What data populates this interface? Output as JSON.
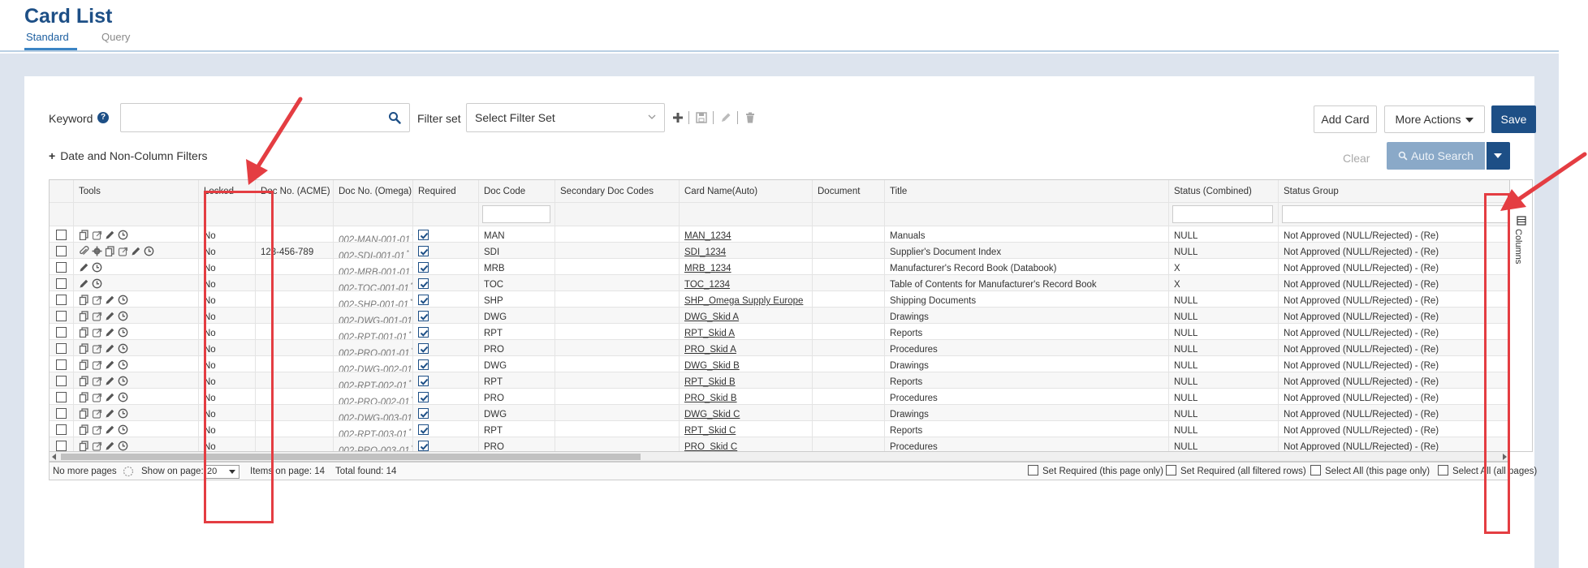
{
  "header": {
    "title": "Card List",
    "tabs": [
      {
        "label": "Standard",
        "active": true
      },
      {
        "label": "Query",
        "active": false
      }
    ]
  },
  "toolbar": {
    "keyword_label": "Keyword",
    "keyword_value": "",
    "filter_set_label": "Filter set",
    "filter_set_value": "Select Filter Set",
    "add_card": "Add Card",
    "more_actions": "More Actions",
    "save": "Save",
    "date_filters": "Date and Non-Column Filters",
    "clear": "Clear",
    "auto_search": "Auto Search"
  },
  "grid": {
    "columns": [
      "Tools",
      "Locked",
      "Doc No. (ACME)",
      "Doc No. (Omega)",
      "Required",
      "Doc Code",
      "Secondary Doc Codes",
      "Card Name(Auto)",
      "Document",
      "Title",
      "Status (Combined)",
      "Status Group"
    ],
    "rows": [
      {
        "tools": [
          "copy",
          "share",
          "pencil",
          "clock"
        ],
        "locked": "No",
        "acme": "",
        "omega": "002-MAN-001-01",
        "doc_code": "MAN",
        "card": "MAN_1234",
        "title": "Manuals",
        "status": "NULL",
        "group": "Not Approved (NULL/Rejected) - (Re)"
      },
      {
        "tools": [
          "clip",
          "gearshare",
          "copy",
          "share",
          "pencil",
          "clock"
        ],
        "locked": "No",
        "acme": "123-456-789",
        "omega": "002-SDI-001-01",
        "doc_code": "SDI",
        "card": "SDI_1234",
        "title": "Supplier's Document Index",
        "status": "NULL",
        "group": "Not Approved (NULL/Rejected) - (Re)"
      },
      {
        "tools": [
          "pencil",
          "clock"
        ],
        "locked": "No",
        "acme": "",
        "omega": "002-MRB-001-01",
        "doc_code": "MRB",
        "card": "MRB_1234",
        "title": "Manufacturer's Record Book (Databook)",
        "status": "X",
        "group": "Not Approved (NULL/Rejected) - (Re)"
      },
      {
        "tools": [
          "pencil",
          "clock"
        ],
        "locked": "No",
        "acme": "",
        "omega": "002-TOC-001-01",
        "doc_code": "TOC",
        "card": "TOC_1234",
        "title": "Table of Contents for Manufacturer's Record Book",
        "status": "X",
        "group": "Not Approved (NULL/Rejected) - (Re)"
      },
      {
        "tools": [
          "copy",
          "share",
          "pencil",
          "clock"
        ],
        "locked": "No",
        "acme": "",
        "omega": "002-SHP-001-01",
        "doc_code": "SHP",
        "card": "SHP_Omega Supply Europe",
        "title": "Shipping Documents",
        "status": "NULL",
        "group": "Not Approved (NULL/Rejected) - (Re)"
      },
      {
        "tools": [
          "copy",
          "share",
          "pencil",
          "clock"
        ],
        "locked": "No",
        "acme": "",
        "omega": "002-DWG-001-01",
        "doc_code": "DWG",
        "card": "DWG_Skid A",
        "title": "Drawings",
        "status": "NULL",
        "group": "Not Approved (NULL/Rejected) - (Re)"
      },
      {
        "tools": [
          "copy",
          "share",
          "pencil",
          "clock"
        ],
        "locked": "No",
        "acme": "",
        "omega": "002-RPT-001-01",
        "doc_code": "RPT",
        "card": "RPT_Skid A",
        "title": "Reports",
        "status": "NULL",
        "group": "Not Approved (NULL/Rejected) - (Re)"
      },
      {
        "tools": [
          "copy",
          "share",
          "pencil",
          "clock"
        ],
        "locked": "No",
        "acme": "",
        "omega": "002-PRO-001-01",
        "doc_code": "PRO",
        "card": "PRO_Skid A",
        "title": "Procedures",
        "status": "NULL",
        "group": "Not Approved (NULL/Rejected) - (Re)"
      },
      {
        "tools": [
          "copy",
          "share",
          "pencil",
          "clock"
        ],
        "locked": "No",
        "acme": "",
        "omega": "002-DWG-002-01",
        "doc_code": "DWG",
        "card": "DWG_Skid B",
        "title": "Drawings",
        "status": "NULL",
        "group": "Not Approved (NULL/Rejected) - (Re)"
      },
      {
        "tools": [
          "copy",
          "share",
          "pencil",
          "clock"
        ],
        "locked": "No",
        "acme": "",
        "omega": "002-RPT-002-01",
        "doc_code": "RPT",
        "card": "RPT_Skid B",
        "title": "Reports",
        "status": "NULL",
        "group": "Not Approved (NULL/Rejected) - (Re)"
      },
      {
        "tools": [
          "copy",
          "share",
          "pencil",
          "clock"
        ],
        "locked": "No",
        "acme": "",
        "omega": "002-PRO-002-01",
        "doc_code": "PRO",
        "card": "PRO_Skid B",
        "title": "Procedures",
        "status": "NULL",
        "group": "Not Approved (NULL/Rejected) - (Re)"
      },
      {
        "tools": [
          "copy",
          "share",
          "pencil",
          "clock"
        ],
        "locked": "No",
        "acme": "",
        "omega": "002-DWG-003-01",
        "doc_code": "DWG",
        "card": "DWG_Skid C",
        "title": "Drawings",
        "status": "NULL",
        "group": "Not Approved (NULL/Rejected) - (Re)"
      },
      {
        "tools": [
          "copy",
          "share",
          "pencil",
          "clock"
        ],
        "locked": "No",
        "acme": "",
        "omega": "002-RPT-003-01",
        "doc_code": "RPT",
        "card": "RPT_Skid C",
        "title": "Reports",
        "status": "NULL",
        "group": "Not Approved (NULL/Rejected) - (Re)"
      },
      {
        "tools": [
          "copy",
          "share",
          "pencil",
          "clock"
        ],
        "locked": "No",
        "acme": "",
        "omega": "002-PRO-003-01",
        "doc_code": "PRO",
        "card": "PRO_Skid C",
        "title": "Procedures",
        "status": "NULL",
        "group": "Not Approved (NULL/Rejected) - (Re)"
      }
    ],
    "omega_marker": "*"
  },
  "footer": {
    "no_more_pages": "No more pages",
    "show_on_page_label": "Show on page:",
    "page_size": "20",
    "items_on_page": "Items on page: 14",
    "total_found": "Total found: 14",
    "set_required_page": "Set Required (this page only)",
    "set_required_all": "Set Required (all filtered rows)",
    "select_all_page": "Select All (this page only)",
    "select_all_all": "Select All (all pages)"
  },
  "columns_tab": "Columns",
  "colors": {
    "brand": "#1d4f86",
    "annotation": "#e43d42",
    "background": "#dde4ee"
  }
}
